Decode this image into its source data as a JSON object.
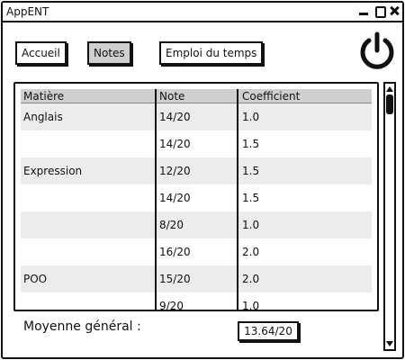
{
  "window": {
    "title": "AppENT"
  },
  "nav": {
    "accueil": "Accueil",
    "notes": "Notes",
    "emploi": "Emploi du temps",
    "active": "Notes"
  },
  "icons": {
    "power": "power-icon"
  },
  "table": {
    "headers": [
      "Matière",
      "Note",
      "Coefficient"
    ],
    "rows": [
      {
        "matiere": "Anglais",
        "note": "14/20",
        "coef": "1.0"
      },
      {
        "matiere": "",
        "note": "14/20",
        "coef": "1.5"
      },
      {
        "matiere": "Expression",
        "note": "12/20",
        "coef": "1.5"
      },
      {
        "matiere": "",
        "note": "14/20",
        "coef": "1.5"
      },
      {
        "matiere": "",
        "note": "8/20",
        "coef": "1.0"
      },
      {
        "matiere": "",
        "note": "16/20",
        "coef": "2.0"
      },
      {
        "matiere": "POO",
        "note": "15/20",
        "coef": "2.0"
      },
      {
        "matiere": "",
        "note": "9/20",
        "coef": "1.0"
      }
    ]
  },
  "average": {
    "label": "Moyenne général :",
    "value": "13.64/20"
  },
  "colors": {
    "header_bg": "#cfcfcf",
    "row_alt": "#ececec",
    "ink": "#111111"
  }
}
